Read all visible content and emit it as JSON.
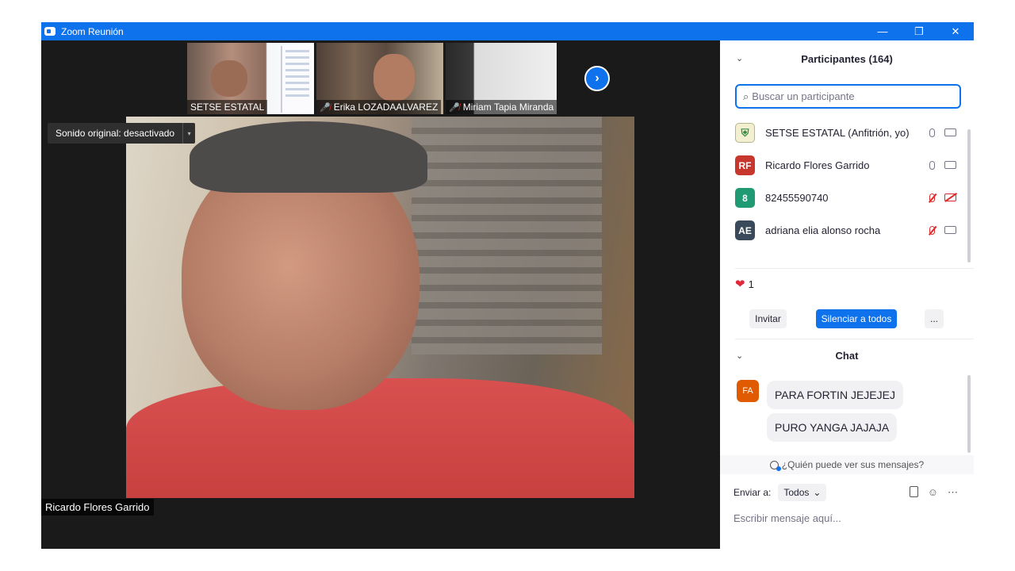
{
  "window": {
    "title": "Zoom Reunión",
    "minimize": "—",
    "restore": "❐",
    "close": "✕"
  },
  "thumbnails": [
    {
      "name": "SETSE ESTATAL",
      "muted": false
    },
    {
      "name": "Erika LOZADAALVAREZ",
      "muted": true
    },
    {
      "name": "Miriam Tapia Miranda",
      "muted": true
    }
  ],
  "next_arrow": "›",
  "sound_toggle": {
    "label": "Sonido original: desactivado",
    "dropdown": "▾"
  },
  "active_speaker": "Ricardo Flores Garrido",
  "participants": {
    "title": "Participantes (164)",
    "search_placeholder": "Buscar un participante",
    "list": [
      {
        "initials": "",
        "name": "SETSE ESTATAL (Anfitrión, yo)",
        "color": "#f3f0d2",
        "mic_off": false,
        "cam_off": false
      },
      {
        "initials": "RF",
        "name": "Ricardo Flores Garrido",
        "color": "#c8372d",
        "mic_off": false,
        "cam_off": false
      },
      {
        "initials": "8",
        "name": "82455590740",
        "color": "#1f9a72",
        "mic_off": true,
        "cam_off": true
      },
      {
        "initials": "AE",
        "name": "adriana elia alonso rocha",
        "color": "#3a4a5a",
        "mic_off": true,
        "cam_off": false
      }
    ],
    "reaction_count": "1",
    "invite": "Invitar",
    "mute_all": "Silenciar a todos",
    "more": "..."
  },
  "chat": {
    "title": "Chat",
    "sender_initials": "FA",
    "messages": [
      "PARA FORTIN JEJEJEJ",
      "PURO YANGA JAJAJA"
    ],
    "who_sees": "¿Quién puede ver sus mensajes?",
    "send_to_label": "Enviar a:",
    "send_to_value": "Todos",
    "compose_placeholder": "Escribir mensaje aquí..."
  },
  "colors": {
    "accent": "#0e72ed",
    "muted": "#e02828",
    "stage": "#1a1a1a"
  }
}
